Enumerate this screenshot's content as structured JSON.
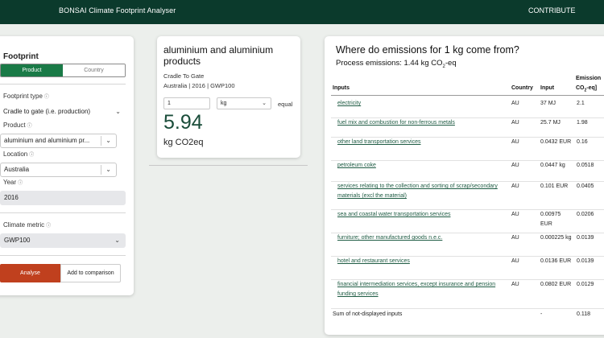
{
  "topbar": {
    "brand": "BONSAI Climate Footprint Analyser",
    "contribute": "CONTRIBUTE"
  },
  "left": {
    "heading": "Footprint",
    "toggle": {
      "product": "Product",
      "country": "Country",
      "selected": "Product"
    },
    "footprint_type_label": "Footprint type",
    "footprint_type_value": "Cradle to gate (i.e. production)",
    "product_label": "Product",
    "product_value": "aluminium and aluminium pr...",
    "location_label": "Location",
    "location_value": "Australia",
    "year_label": "Year",
    "year_value": "2016",
    "climate_metric_label": "Climate metric",
    "climate_metric_value": "GWP100",
    "analyse_label": "Analyse",
    "compare_label": "Add to comparison"
  },
  "result": {
    "title": "aluminium and aluminium products",
    "scope": "Cradle To Gate",
    "meta": "Australia | 2016 | GWP100",
    "quantity": "1",
    "unit": "kg",
    "equal_label": "equal",
    "value": "5.94",
    "value_unit": "kg CO2eq"
  },
  "emissions": {
    "question": "Where do emissions for 1 kg come from?",
    "process_label": "Process emissions: 1.44 kg CO",
    "process_sub": "2",
    "process_tail": "-eq",
    "headers": {
      "inputs": "Inputs",
      "country": "Country",
      "input": "Input",
      "emissions_1": "Emission",
      "emissions_2a": "CO",
      "emissions_2b": "2",
      "emissions_2c": "-eq]"
    },
    "rows": [
      {
        "name": "electricity",
        "country": "AU",
        "input": "37 MJ",
        "emissions": "2.1"
      },
      {
        "name": "fuel mix and combustion for non-ferrous metals",
        "country": "AU",
        "input": "25.7 MJ",
        "emissions": "1.98"
      },
      {
        "name": "other land transportation services",
        "country": "AU",
        "input": "0.0432 EUR",
        "emissions": "0.16"
      },
      {
        "name": "petroleum coke",
        "country": "AU",
        "input": "0.0447 kg",
        "emissions": "0.0518"
      },
      {
        "name": "services relating to the collection and sorting of scrap/secondary materials (excl the material)",
        "country": "AU",
        "input": "0.101 EUR",
        "emissions": "0.0405"
      },
      {
        "name": "sea and coastal water transportation services",
        "country": "AU",
        "input": "0.00975 EUR",
        "emissions": "0.0206"
      },
      {
        "name": "furniture; other manufactured goods n.e.c.",
        "country": "AU",
        "input": "0.000225 kg",
        "emissions": "0.0139"
      },
      {
        "name": "hotel and restaurant services",
        "country": "AU",
        "input": "0.0136 EUR",
        "emissions": "0.0139"
      },
      {
        "name": "financial intermediation services, except insurance and pension funding services",
        "country": "AU",
        "input": "0.0802 EUR",
        "emissions": "0.0129"
      }
    ],
    "sum_row": {
      "name": "Sum of not-displayed inputs",
      "input": "-",
      "emissions": "0.118"
    }
  }
}
